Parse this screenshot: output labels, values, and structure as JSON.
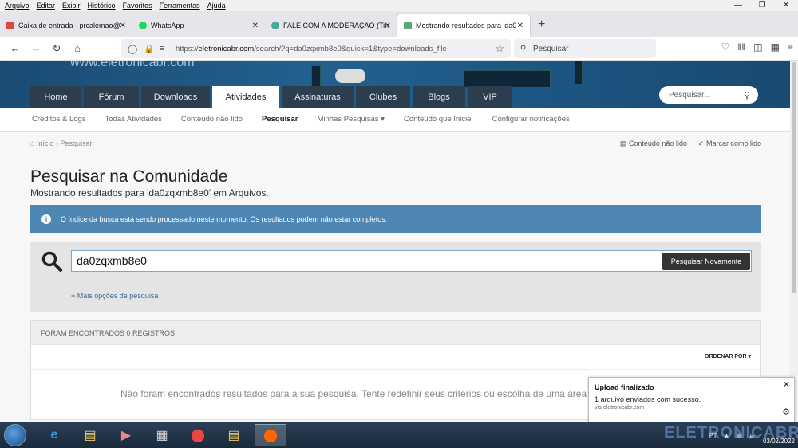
{
  "menubar": [
    "Arquivo",
    "Editar",
    "Exibir",
    "Histórico",
    "Favoritos",
    "Ferramentas",
    "Ajuda"
  ],
  "tabs": [
    {
      "title": "Caixa de entrada - prcalemao@"
    },
    {
      "title": "WhatsApp"
    },
    {
      "title": "FALE COM A MODERAÇÃO (Tin"
    },
    {
      "title": "Mostrando resultados para 'da0"
    }
  ],
  "url": {
    "prefix": "https://",
    "domain": "eletronicabr.com",
    "path": "/search/?q=da0zqxmb8e0&quick=1&type=downloads_file"
  },
  "browser_search": "Pesquisar",
  "site": {
    "logo": "www.eletronicabr.com",
    "nav": [
      "Home",
      "Fórum",
      "Downloads",
      "Atividades",
      "Assinaturas",
      "Clubes",
      "Blogs",
      "VIP"
    ],
    "search_placeholder": "Pesquisar..."
  },
  "subnav": [
    "Créditos & Logs",
    "Todas Atividades",
    "Conteúdo não lido",
    "Pesquisar",
    "Minhas Pesquisas ▾",
    "Conteúdo que Iniciei",
    "Configurar notificações"
  ],
  "breadcrumb": {
    "home": "Início",
    "sep": "›",
    "current": "Pesquisar"
  },
  "crumb_actions": {
    "unread": "Conteúdo não lido",
    "mark": "Marcar como lido"
  },
  "page": {
    "title": "Pesquisar na Comunidade",
    "subtitle": "Mostrando resultados para 'da0zqxmb8e0' em Arquivos."
  },
  "info": "O índice da busca está sendo processado neste momento. Os resultados podem não estar completos.",
  "search": {
    "value": "da0zqxmb8e0",
    "button": "Pesquisar Novamente",
    "more": "Mais opções de pesquisa"
  },
  "results": {
    "header": "FORAM ENCONTRADOS 0 REGISTROS",
    "sort": "ORDENAR POR ▾",
    "empty": "Não foram encontrados resultados para a sua pesquisa. Tente redefinir seus critérios ou escolha de uma área de"
  },
  "toast": {
    "title": "Upload finalizado",
    "message": "1 arquivo enviados com sucesso.",
    "source": "via eletronicabr.com"
  },
  "tray": {
    "lang": "PT",
    "date": "03/02/2022"
  },
  "watermark": "ELETRONICABR"
}
